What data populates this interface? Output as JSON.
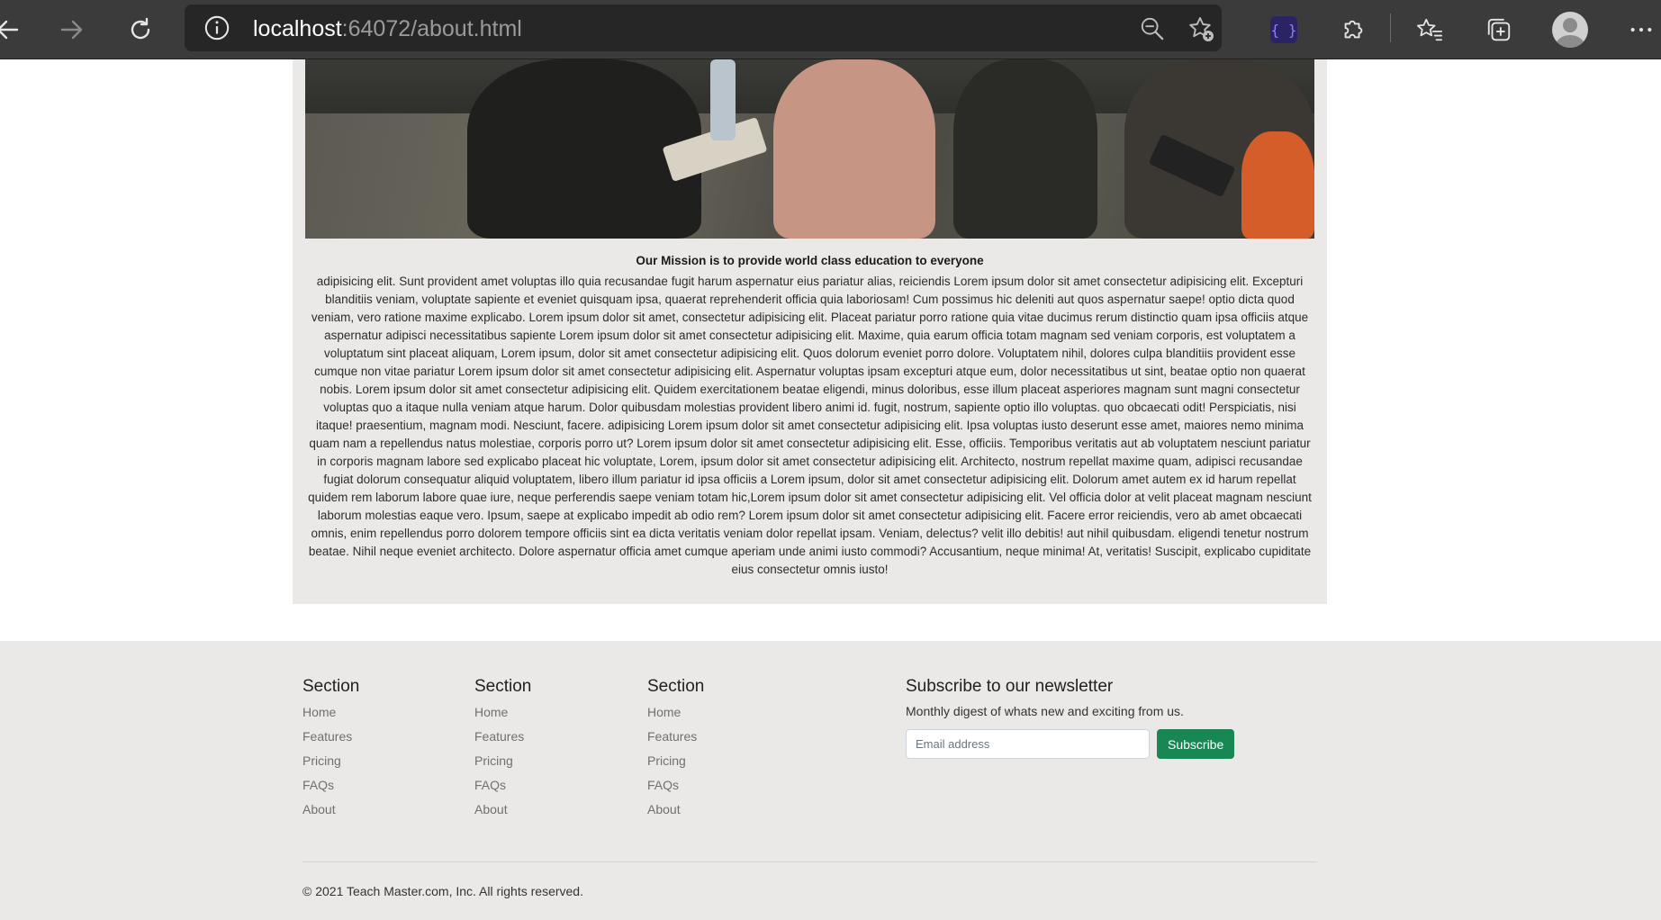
{
  "browser": {
    "url_host": "localhost",
    "url_rest": ":64072/about.html"
  },
  "mission": {
    "title": "Our Mission is to provide world class education to everyone",
    "body": "adipisicing elit. Sunt provident amet voluptas illo quia recusandae fugit harum aspernatur eius pariatur alias, reiciendis Lorem ipsum dolor sit amet consectetur adipisicing elit. Excepturi blanditiis veniam, voluptate sapiente et eveniet quisquam ipsa, quaerat reprehenderit officia quia laboriosam! Cum possimus hic deleniti aut quos aspernatur saepe! optio dicta quod veniam, vero ratione maxime explicabo. Lorem ipsum dolor sit amet, consectetur adipisicing elit. Placeat pariatur porro ratione quia vitae ducimus rerum distinctio quam ipsa officiis atque aspernatur adipisci necessitatibus sapiente Lorem ipsum dolor sit amet consectetur adipisicing elit. Maxime, quia earum officia totam magnam sed veniam corporis, est voluptatem a voluptatum sint placeat aliquam, Lorem ipsum, dolor sit amet consectetur adipisicing elit. Quos dolorum eveniet porro dolore. Voluptatem nihil, dolores culpa blanditiis provident esse cumque non vitae pariatur Lorem ipsum dolor sit amet consectetur adipisicing elit. Aspernatur voluptas ipsam excepturi atque eum, dolor necessitatibus ut sint, beatae optio non quaerat nobis. Lorem ipsum dolor sit amet consectetur adipisicing elit. Quidem exercitationem beatae eligendi, minus doloribus, esse illum placeat asperiores magnam sunt magni consectetur voluptas quo a itaque nulla veniam atque harum. Dolor quibusdam molestias provident libero animi id. fugit, nostrum, sapiente optio illo voluptas. quo obcaecati odit! Perspiciatis, nisi itaque! praesentium, magnam modi. Nesciunt, facere. adipisicing Lorem ipsum dolor sit amet consectetur adipisicing elit. Ipsa voluptas iusto deserunt esse amet, maiores nemo minima quam nam a repellendus natus molestiae, corporis porro ut? Lorem ipsum dolor sit amet consectetur adipisicing elit. Esse, officiis. Temporibus veritatis aut ab voluptatem nesciunt pariatur in corporis magnam labore sed explicabo placeat hic voluptate, Lorem, ipsum dolor sit amet consectetur adipisicing elit. Architecto, nostrum repellat maxime quam, adipisci recusandae fugiat dolorum consequatur aliquid voluptatem, libero illum pariatur id ipsa officiis a Lorem ipsum, dolor sit amet consectetur adipisicing elit. Dolorum amet autem ex id harum repellat quidem rem laborum labore quae iure, neque perferendis saepe veniam totam hic,Lorem ipsum dolor sit amet consectetur adipisicing elit. Vel officia dolor at velit placeat magnam nesciunt laborum molestias eaque vero. Ipsum, saepe at explicabo impedit ab odio rem? Lorem ipsum dolor sit amet consectetur adipisicing elit. Facere error reiciendis, vero ab amet obcaecati omnis, enim repellendus porro dolorem tempore officiis sint ea dicta veritatis veniam dolor repellat ipsam. Veniam, delectus? velit illo debitis! aut nihil quibusdam. eligendi tenetur nostrum beatae. Nihil neque eveniet architecto. Dolore aspernatur officia amet cumque aperiam unde animi iusto commodi? Accusantium, neque minima! At, veritatis! Suscipit, explicabo cupiditate eius consectetur omnis iusto!"
  },
  "footer": {
    "columns": [
      {
        "heading": "Section",
        "links": [
          "Home",
          "Features",
          "Pricing",
          "FAQs",
          "About"
        ]
      },
      {
        "heading": "Section",
        "links": [
          "Home",
          "Features",
          "Pricing",
          "FAQs",
          "About"
        ]
      },
      {
        "heading": "Section",
        "links": [
          "Home",
          "Features",
          "Pricing",
          "FAQs",
          "About"
        ]
      }
    ],
    "newsletter": {
      "heading": "Subscribe to our newsletter",
      "subtext": "Monthly digest of whats new and exciting from us.",
      "email_placeholder": "Email address",
      "button_label": "Subscribe"
    },
    "copyright": "© 2021 Teach Master.com, Inc. All rights reserved."
  },
  "colors": {
    "chrome_bg": "#3b3b3b",
    "card_bg": "#ebe8e8",
    "button_green": "#198754"
  },
  "icons": [
    "back-arrow-icon",
    "forward-arrow-icon",
    "refresh-icon",
    "site-info-icon",
    "zoom-out-icon",
    "add-favorite-icon",
    "braces-extension-icon",
    "extensions-puzzle-icon",
    "favorites-icon",
    "collections-icon",
    "profile-avatar-icon",
    "more-menu-icon"
  ]
}
